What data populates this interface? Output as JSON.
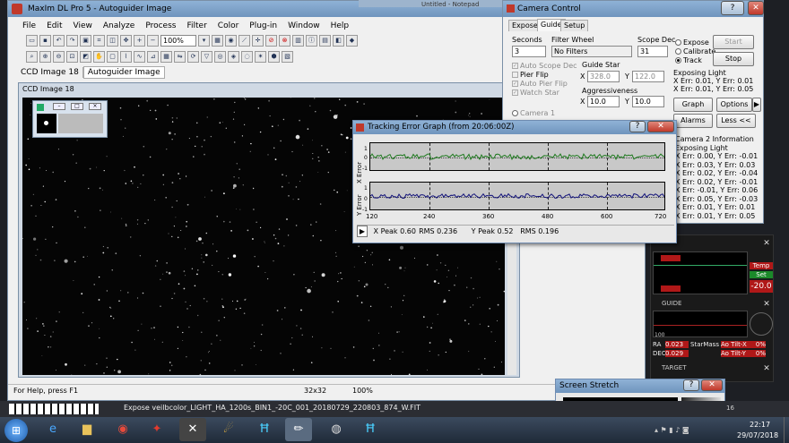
{
  "app": {
    "title": "MaxIm DL Pro 5 - Autoguider Image",
    "menu": [
      "File",
      "Edit",
      "View",
      "Analyze",
      "Process",
      "Filter",
      "Color",
      "Plug-in",
      "Window",
      "Help"
    ],
    "zoom": "100%",
    "doc_tabs": [
      "CCD Image 18",
      "Autoguider Image"
    ],
    "behind_title": "Untitled - Notepad",
    "status_help": "For Help, press F1",
    "status_size": "32x32",
    "status_zoom": "100%"
  },
  "ccd_window": {
    "title": "CCD Image 18"
  },
  "camera_control": {
    "title": "Camera Control",
    "tabs": [
      "Expose",
      "Guide",
      "Setup"
    ],
    "active_tab": "Guide",
    "seconds_label": "Seconds",
    "seconds_value": "3",
    "filter_wheel_label": "Filter Wheel",
    "filter_value": "No Filters",
    "scope_dec_label": "Scope Dec",
    "scope_dec_value": "31",
    "mode_expose": "Expose",
    "mode_calibrate": "Calibrate",
    "mode_track": "Track",
    "start_label": "Start",
    "stop_label": "Stop",
    "auto_scope_dec": "Auto Scope Dec",
    "pier_flip": "Pier Flip",
    "auto_pier_flip": "Auto Pier Flip",
    "watch_star": "Watch Star",
    "camera1": "Camera 1",
    "guide_star_label": "Guide Star",
    "guide_star_x_label": "X",
    "guide_star_x": "328.0",
    "guide_star_y_label": "Y",
    "guide_star_y": "122.0",
    "aggressiveness_label": "Aggressiveness",
    "aggr_x_label": "X",
    "aggr_x": "10.0",
    "aggr_y_label": "Y",
    "aggr_y": "10.0",
    "status_line1": "Exposing Light",
    "status_line2": "X Err: 0.01, Y Err: 0.01",
    "status_line3": "X Err: 0.01, Y Err: 0.05",
    "graph_label": "Graph",
    "options_label": "Options",
    "alarms_label": "Alarms",
    "less_label": "Less <<",
    "camera2_info": "Camera 2 Information",
    "camera2_status": "Exposing Light",
    "log": [
      "X Err: 0.00, Y Err: -0.01",
      "X Err: 0.03, Y Err: 0.03",
      "X Err: 0.02, Y Err: -0.04",
      "X Err: 0.02, Y Err: -0.01",
      "X Err: -0.01, Y Err: 0.06",
      "X Err: 0.05, Y Err: -0.03",
      "X Err: 0.01, Y Err: 0.01",
      "X Err: 0.01, Y Err: 0.05"
    ]
  },
  "tracking_graph": {
    "title": "Tracking Error Graph (from 20:06:00Z)",
    "x_axis_label": "X Error",
    "y_axis_label": "Y Error",
    "tick_pos": "1",
    "tick_zero": "0",
    "tick_neg": "-1",
    "x_ticks": [
      "120",
      "240",
      "360",
      "480",
      "600",
      "720"
    ],
    "x_peak": "X Peak 0.60",
    "x_rms": "RMS 0.236",
    "y_peak": "Y Peak 0.52",
    "y_rms": "RMS 0.196",
    "x_color": "#1e7a1e",
    "y_color": "#12127a"
  },
  "right_panels": {
    "temp_label": "Temp",
    "set_label": "Set",
    "temp_value": "-20.0",
    "guide_title": "GUIDE",
    "target_title": "TARGET",
    "ra_label": "RA",
    "dec_label": "DEC",
    "ra_value": "0.023",
    "dec_value": "0.029",
    "starmass_label": "StarMass",
    "ao_tilt_x": "Ao Tilt-X",
    "ao_tilt_y": "Ao Tilt-Y",
    "pct": "0%",
    "pct2": "0%",
    "scale_100": "100"
  },
  "screen_stretch": {
    "title": "Screen Stretch"
  },
  "bottom_bar": {
    "expose_text": "Expose veilbcolor_LIGHT_HA_1200s_BIN1_-20C_001_20180729_220803_874_W.FIT",
    "num_16": "16"
  },
  "taskbar": {
    "time": "22:17",
    "date": "29/07/2018"
  }
}
